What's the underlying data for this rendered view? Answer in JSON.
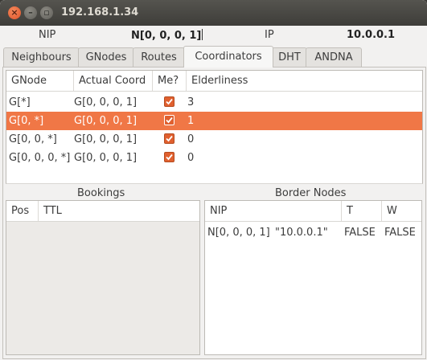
{
  "window": {
    "title": "192.168.1.34"
  },
  "info": {
    "nip_label": "NIP",
    "nip_value": "N[0, 0, 0, 1]",
    "ip_label": "IP",
    "ip_value": "10.0.0.1"
  },
  "tabs": [
    "Neighbours",
    "GNodes",
    "Routes",
    "Coordinators",
    "DHT",
    "ANDNA"
  ],
  "active_tab": "Coordinators",
  "coordinators": {
    "columns": [
      "GNode",
      "Actual Coord",
      "Me?",
      "Elderliness"
    ],
    "rows": [
      {
        "gnode": "G[*]",
        "coord": "G[0, 0, 0, 1]",
        "me": true,
        "elder": "3",
        "selected": false
      },
      {
        "gnode": "G[0, *]",
        "coord": "G[0, 0, 0, 1]",
        "me": true,
        "elder": "1",
        "selected": true
      },
      {
        "gnode": "G[0, 0, *]",
        "coord": "G[0, 0, 0, 1]",
        "me": true,
        "elder": "0",
        "selected": false
      },
      {
        "gnode": "G[0, 0, 0, *]",
        "coord": "G[0, 0, 0, 1]",
        "me": true,
        "elder": "0",
        "selected": false
      }
    ]
  },
  "bookings": {
    "title": "Bookings",
    "columns": [
      "Pos",
      "TTL"
    ]
  },
  "border_nodes": {
    "title": "Border Nodes",
    "columns": [
      "NIP",
      "T",
      "W"
    ],
    "rows": [
      {
        "nip": "N[0, 0, 0, 1]",
        "ip": "\"10.0.0.1\"",
        "t": "FALSE",
        "w": "FALSE"
      }
    ]
  },
  "colors": {
    "selection": "#f07746",
    "titlebar": "#3e3d39",
    "window_bg": "#f2f1f0"
  }
}
